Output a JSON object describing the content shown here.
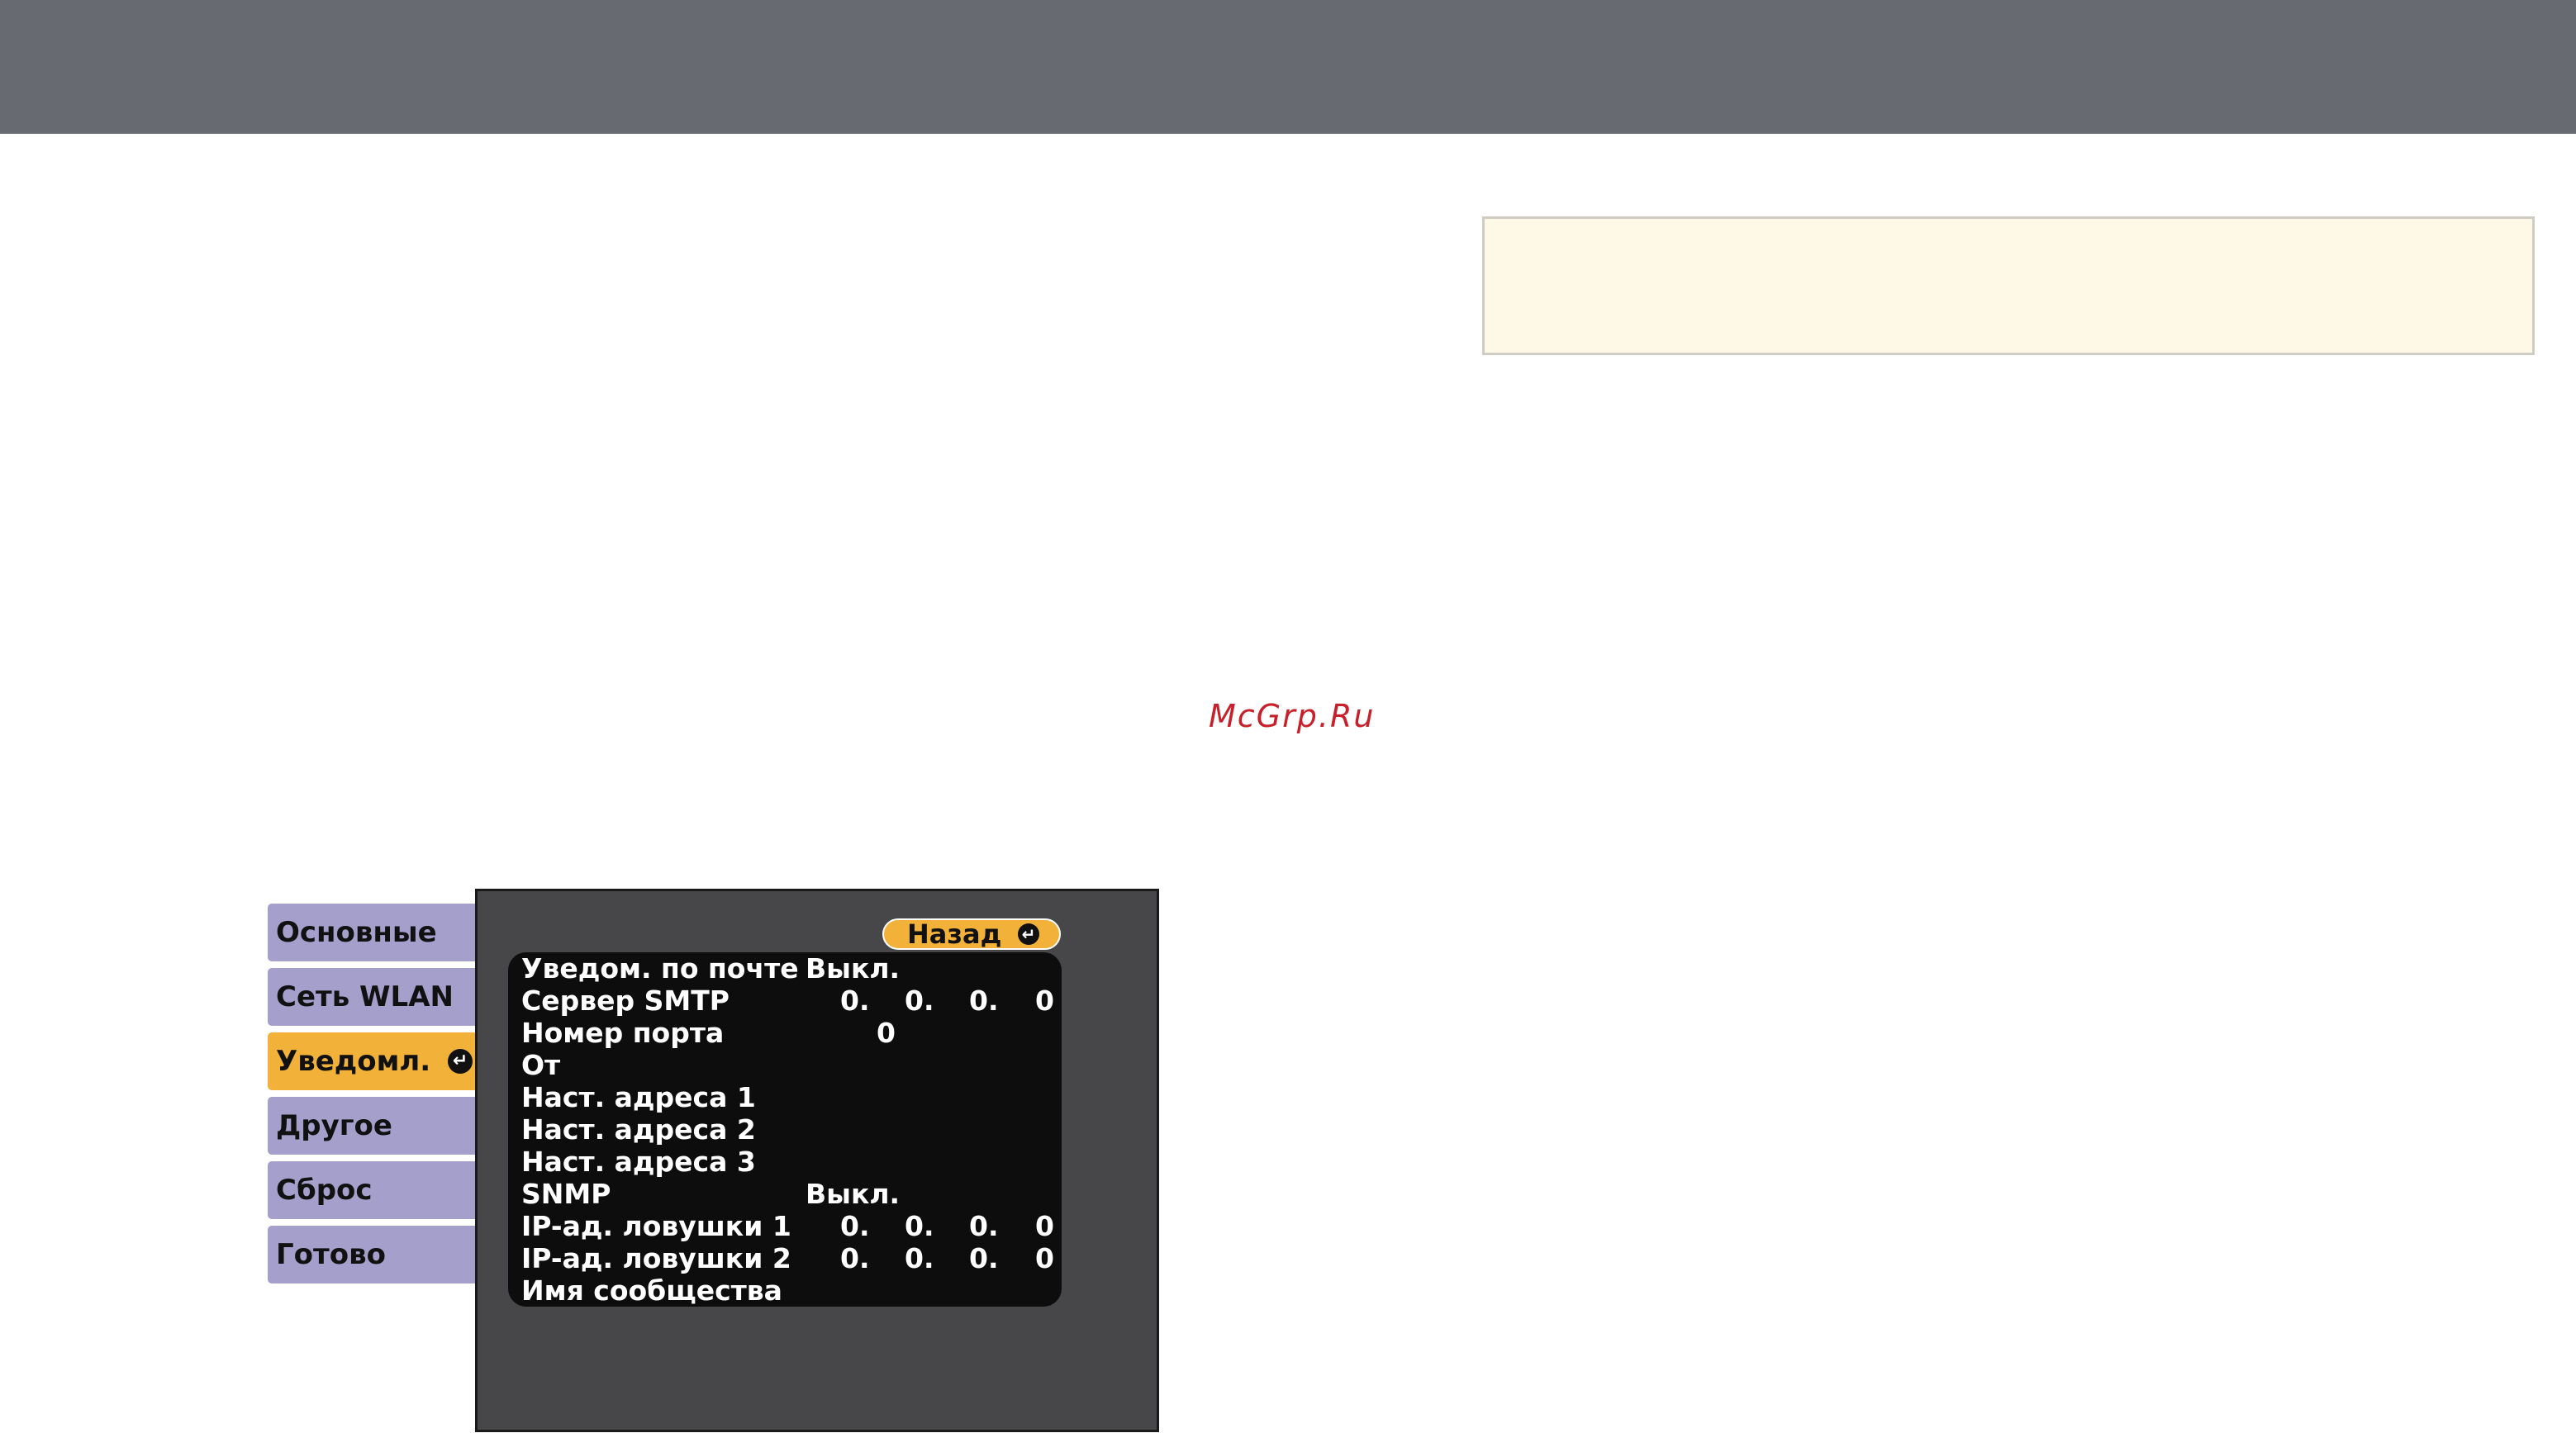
{
  "watermark": "McGrp.Ru",
  "tabs": [
    {
      "label": "Основные",
      "active": false
    },
    {
      "label": "Сеть WLAN",
      "active": false
    },
    {
      "label": "Уведомл.",
      "active": true
    },
    {
      "label": "Другое",
      "active": false
    },
    {
      "label": "Сброс",
      "active": false
    },
    {
      "label": "Готово",
      "active": false
    }
  ],
  "panel": {
    "back_label": "Назад",
    "rows": [
      {
        "label": "Уведом. по почте",
        "value": "Выкл."
      },
      {
        "label": "Сервер SMTP",
        "ip": [
          "0.",
          "0.",
          "0.",
          "0"
        ]
      },
      {
        "label": "Номер порта",
        "port": "0"
      },
      {
        "label": "От"
      },
      {
        "label": "Наст. адреса 1"
      },
      {
        "label": "Наст. адреса 2"
      },
      {
        "label": "Наст. адреса 3"
      },
      {
        "label": "SNMP",
        "value": "Выкл."
      },
      {
        "label": "IP-ад. ловушки 1",
        "ip": [
          "0.",
          "0.",
          "0.",
          "0"
        ]
      },
      {
        "label": "IP-ад. ловушки 2",
        "ip": [
          "0.",
          "0.",
          "0.",
          "0"
        ]
      },
      {
        "label": "Имя сообщества"
      }
    ]
  },
  "colors": {
    "header": "#686a72",
    "tab": "#a59fcc",
    "active_tab": "#f2b23a",
    "note_box": "#fef8e6",
    "panel": "#47474a"
  }
}
